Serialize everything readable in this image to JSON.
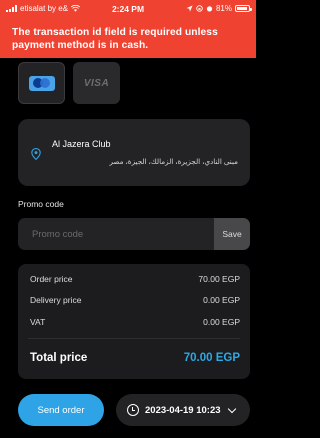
{
  "status_bar": {
    "carrier": "etisalat by e&",
    "time": "2:24 PM",
    "battery": "81%"
  },
  "error": {
    "message": "The transaction id field is required unless payment method is in cash."
  },
  "payment_methods": [
    {
      "name": "mastercard",
      "label": "",
      "selected": true
    },
    {
      "name": "visa",
      "label": "VISA",
      "selected": false
    }
  ],
  "address": {
    "name": "Al Jazera Club",
    "line": "مبنى النادي، الجزيرة، الزمالك، الجيزة، مصر",
    "icon": "location-pin-icon"
  },
  "promo": {
    "label": "Promo code",
    "placeholder": "Promo code",
    "value": "",
    "save_label": "Save"
  },
  "summary": {
    "order_price_label": "Order price",
    "order_price_value": "70.00 EGP",
    "delivery_price_label": "Delivery price",
    "delivery_price_value": "0.00 EGP",
    "vat_label": "VAT",
    "vat_value": "0.00 EGP",
    "total_label": "Total price",
    "total_value": "70.00 EGP"
  },
  "actions": {
    "send_label": "Send order",
    "schedule_label": "2023-04-19 10:23"
  },
  "colors": {
    "error_banner": "#ef4231",
    "accent": "#2ea3e6",
    "card_bg": "#232325"
  }
}
